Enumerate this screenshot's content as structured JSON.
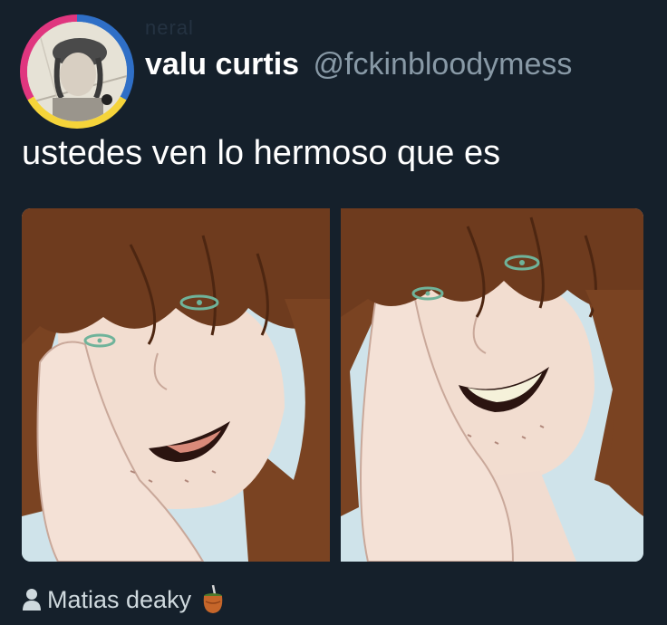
{
  "tweet": {
    "display_name": "valu curtis",
    "handle": "@fckinbloodymess",
    "text": "ustedes ven lo hermoso que es"
  },
  "images": {
    "left": "drawing-of-smiling-long-haired-man-left",
    "right": "drawing-of-smiling-long-haired-man-right"
  },
  "footer": {
    "author": "Matias deaky",
    "person_icon": "person-icon",
    "emoji": "mate-cup-icon"
  },
  "colors": {
    "background": "#15202b",
    "handle": "#8899a6",
    "hair": "#7a4322",
    "skin": "#f2ddd0",
    "eyes": "#6fb39a"
  }
}
